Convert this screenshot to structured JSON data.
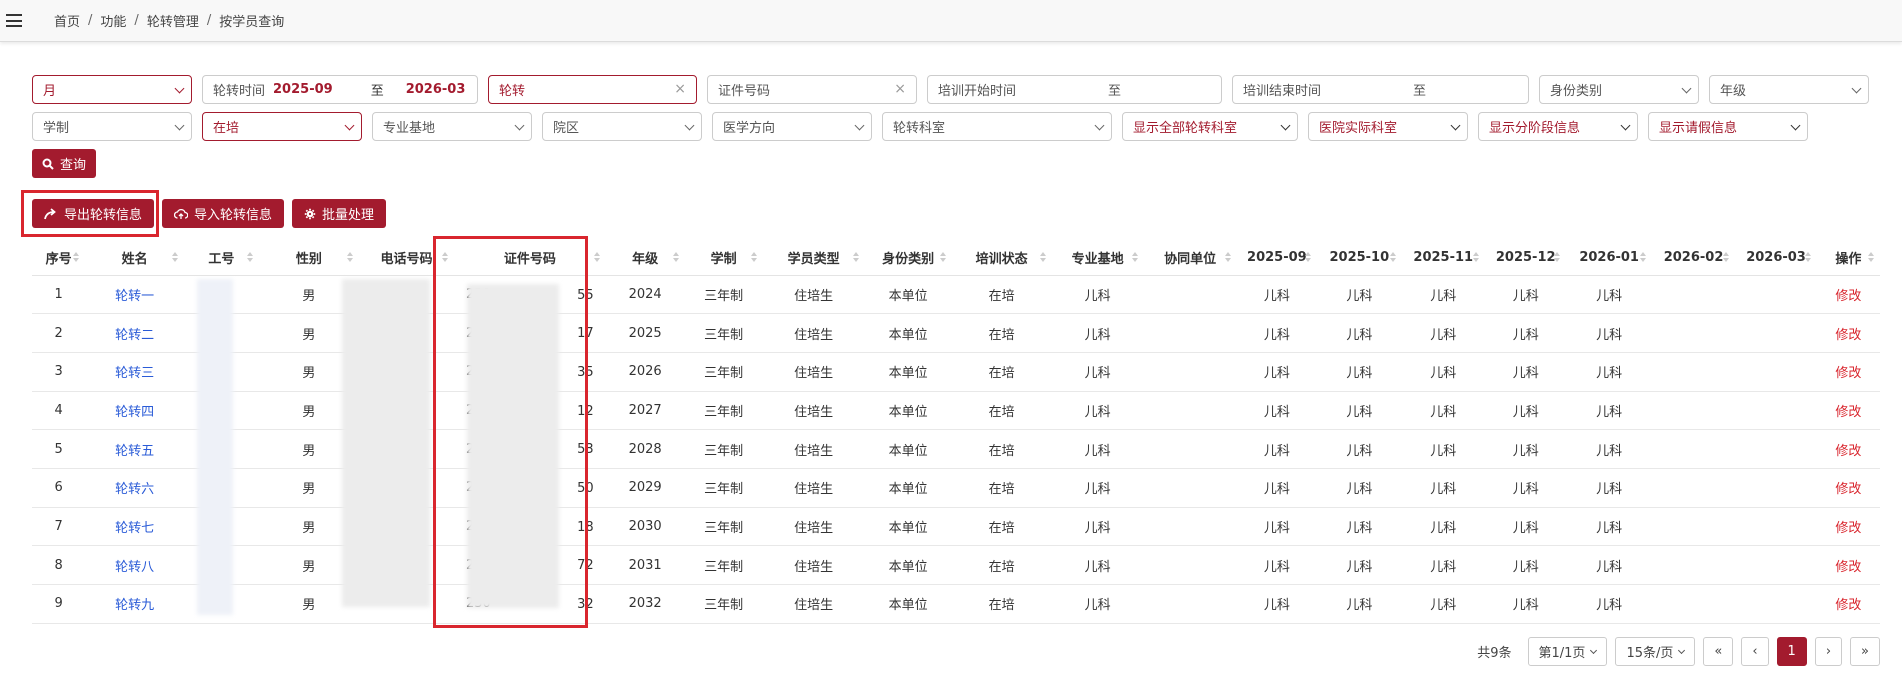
{
  "breadcrumb": [
    "首页",
    "功能",
    "轮转管理",
    "按学员查询"
  ],
  "filters": {
    "period_unit": "月",
    "rotation_time_label": "轮转时间",
    "rotation_start": "2025-09",
    "rotation_to": "至",
    "rotation_end": "2026-03",
    "name_value": "轮转",
    "id_placeholder": "证件号码",
    "train_start_label": "培训开始时间",
    "train_start_to": "至",
    "train_end_label": "培训结束时间",
    "train_end_to": "至",
    "identity_type": "身份类别",
    "grade": "年级",
    "school_system": "学制",
    "status": "在培",
    "base": "专业基地",
    "campus": "院区",
    "direction": "医学方向",
    "dept": "轮转科室",
    "show_all_depts": "显示全部轮转科室",
    "hospital_dept": "医院实际科室",
    "show_stage": "显示分阶段信息",
    "show_leave": "显示请假信息",
    "query_label": "查询"
  },
  "actions": {
    "export_label": "导出轮转信息",
    "import_label": "导入轮转信息",
    "batch_label": "批量处理"
  },
  "table": {
    "headers": [
      "序号",
      "姓名",
      "工号",
      "性别",
      "电话号码",
      "证件号码",
      "年级",
      "学制",
      "学员类型",
      "身份类别",
      "培训状态",
      "专业基地",
      "协同单位",
      "2025-09",
      "2025-10",
      "2025-11",
      "2025-12",
      "2026-01",
      "2026-02",
      "2026-03",
      "操作"
    ],
    "rows": [
      {
        "no": "1",
        "name": "轮转一",
        "sex": "男",
        "id_head": "230",
        "id_tail": "55",
        "grade": "2024",
        "system": "三年制",
        "type": "住培生",
        "identity": "本单位",
        "status": "在培",
        "base": "儿科",
        "m1": "儿科",
        "m2": "儿科",
        "m3": "儿科",
        "m4": "儿科",
        "m5": "儿科",
        "op": "修改"
      },
      {
        "no": "2",
        "name": "轮转二",
        "sex": "男",
        "id_head": "230",
        "id_tail": "17",
        "grade": "2025",
        "system": "三年制",
        "type": "住培生",
        "identity": "本单位",
        "status": "在培",
        "base": "儿科",
        "m1": "儿科",
        "m2": "儿科",
        "m3": "儿科",
        "m4": "儿科",
        "m5": "儿科",
        "op": "修改"
      },
      {
        "no": "3",
        "name": "轮转三",
        "sex": "男",
        "id_head": "230",
        "id_tail": "35",
        "grade": "2026",
        "system": "三年制",
        "type": "住培生",
        "identity": "本单位",
        "status": "在培",
        "base": "儿科",
        "m1": "儿科",
        "m2": "儿科",
        "m3": "儿科",
        "m4": "儿科",
        "m5": "儿科",
        "op": "修改"
      },
      {
        "no": "4",
        "name": "轮转四",
        "sex": "男",
        "id_head": "230",
        "id_tail": "12",
        "grade": "2027",
        "system": "三年制",
        "type": "住培生",
        "identity": "本单位",
        "status": "在培",
        "base": "儿科",
        "m1": "儿科",
        "m2": "儿科",
        "m3": "儿科",
        "m4": "儿科",
        "m5": "儿科",
        "op": "修改"
      },
      {
        "no": "5",
        "name": "轮转五",
        "sex": "男",
        "id_head": "230",
        "id_tail": "53",
        "grade": "2028",
        "system": "三年制",
        "type": "住培生",
        "identity": "本单位",
        "status": "在培",
        "base": "儿科",
        "m1": "儿科",
        "m2": "儿科",
        "m3": "儿科",
        "m4": "儿科",
        "m5": "儿科",
        "op": "修改"
      },
      {
        "no": "6",
        "name": "轮转六",
        "sex": "男",
        "id_head": "230",
        "id_tail": "50",
        "grade": "2029",
        "system": "三年制",
        "type": "住培生",
        "identity": "本单位",
        "status": "在培",
        "base": "儿科",
        "m1": "儿科",
        "m2": "儿科",
        "m3": "儿科",
        "m4": "儿科",
        "m5": "儿科",
        "op": "修改"
      },
      {
        "no": "7",
        "name": "轮转七",
        "sex": "男",
        "id_head": "230",
        "id_tail": "18",
        "grade": "2030",
        "system": "三年制",
        "type": "住培生",
        "identity": "本单位",
        "status": "在培",
        "base": "儿科",
        "m1": "儿科",
        "m2": "儿科",
        "m3": "儿科",
        "m4": "儿科",
        "m5": "儿科",
        "op": "修改"
      },
      {
        "no": "8",
        "name": "轮转八",
        "sex": "男",
        "id_head": "230",
        "id_tail": "72",
        "grade": "2031",
        "system": "三年制",
        "type": "住培生",
        "identity": "本单位",
        "status": "在培",
        "base": "儿科",
        "m1": "儿科",
        "m2": "儿科",
        "m3": "儿科",
        "m4": "儿科",
        "m5": "儿科",
        "op": "修改"
      },
      {
        "no": "9",
        "name": "轮转九",
        "sex": "男",
        "id_head": "230",
        "id_tail": "32",
        "grade": "2032",
        "system": "三年制",
        "type": "住培生",
        "identity": "本单位",
        "status": "在培",
        "base": "儿科",
        "m1": "儿科",
        "m2": "儿科",
        "m3": "儿科",
        "m4": "儿科",
        "m5": "儿科",
        "op": "修改"
      }
    ]
  },
  "pager": {
    "total": "共9条",
    "page": "第1/1页",
    "per_page": "15条/页",
    "first": "«",
    "prev": "‹",
    "current": "1",
    "next": "›",
    "last": "»"
  },
  "colors": {
    "accent": "#a31b2e",
    "highlight": "#d9262e",
    "link": "#2a5bd7"
  }
}
